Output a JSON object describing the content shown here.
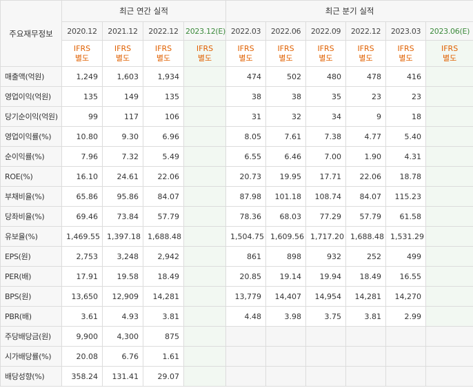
{
  "header": {
    "corner_label": "주요재무정보",
    "annual_group": "최근 연간 실적",
    "quarter_group": "최근 분기 실적",
    "annual_periods": [
      "2020.12",
      "2021.12",
      "2022.12",
      "2023.12(E)"
    ],
    "quarter_periods": [
      "2022.03",
      "2022.06",
      "2022.09",
      "2022.12",
      "2023.03",
      "2023.06(E)"
    ],
    "ifrs_line1": "IFRS",
    "ifrs_line2": "별도"
  },
  "colors": {
    "ifrs_orange": "#e06000",
    "estimate_green": "#3c8a3c",
    "estimate_bg": "#f2f8f2",
    "label_bg": "#f7f7f7"
  },
  "rows": [
    {
      "label": "매출액(억원)",
      "annual": [
        "1,249",
        "1,603",
        "1,934",
        ""
      ],
      "quarter": [
        "474",
        "502",
        "480",
        "478",
        "416",
        ""
      ]
    },
    {
      "label": "영업이익(억원)",
      "annual": [
        "135",
        "149",
        "135",
        ""
      ],
      "quarter": [
        "38",
        "38",
        "35",
        "23",
        "23",
        ""
      ]
    },
    {
      "label": "당기순이익(억원)",
      "annual": [
        "99",
        "117",
        "106",
        ""
      ],
      "quarter": [
        "31",
        "32",
        "34",
        "9",
        "18",
        ""
      ]
    },
    {
      "label": "영업이익률(%)",
      "annual": [
        "10.80",
        "9.30",
        "6.96",
        ""
      ],
      "quarter": [
        "8.05",
        "7.61",
        "7.38",
        "4.77",
        "5.40",
        ""
      ]
    },
    {
      "label": "순이익률(%)",
      "annual": [
        "7.96",
        "7.32",
        "5.49",
        ""
      ],
      "quarter": [
        "6.55",
        "6.46",
        "7.00",
        "1.90",
        "4.31",
        ""
      ]
    },
    {
      "label": "ROE(%)",
      "annual": [
        "16.10",
        "24.61",
        "22.06",
        ""
      ],
      "quarter": [
        "20.73",
        "19.95",
        "17.71",
        "22.06",
        "18.78",
        ""
      ]
    },
    {
      "label": "부채비율(%)",
      "annual": [
        "65.86",
        "95.86",
        "84.07",
        ""
      ],
      "quarter": [
        "87.98",
        "101.18",
        "108.74",
        "84.07",
        "115.23",
        ""
      ]
    },
    {
      "label": "당좌비율(%)",
      "annual": [
        "69.46",
        "73.84",
        "57.79",
        ""
      ],
      "quarter": [
        "78.36",
        "68.03",
        "77.29",
        "57.79",
        "61.58",
        ""
      ]
    },
    {
      "label": "유보율(%)",
      "annual": [
        "1,469.55",
        "1,397.18",
        "1,688.48",
        ""
      ],
      "quarter": [
        "1,504.75",
        "1,609.56",
        "1,717.20",
        "1,688.48",
        "1,531.29",
        ""
      ]
    },
    {
      "label": "EPS(원)",
      "annual": [
        "2,753",
        "3,248",
        "2,942",
        ""
      ],
      "quarter": [
        "861",
        "898",
        "932",
        "252",
        "499",
        ""
      ]
    },
    {
      "label": "PER(배)",
      "annual": [
        "17.91",
        "19.58",
        "18.49",
        ""
      ],
      "quarter": [
        "20.85",
        "19.14",
        "19.94",
        "18.49",
        "16.55",
        ""
      ]
    },
    {
      "label": "BPS(원)",
      "annual": [
        "13,650",
        "12,909",
        "14,281",
        ""
      ],
      "quarter": [
        "13,779",
        "14,407",
        "14,954",
        "14,281",
        "14,270",
        ""
      ]
    },
    {
      "label": "PBR(배)",
      "annual": [
        "3.61",
        "4.93",
        "3.81",
        ""
      ],
      "quarter": [
        "4.48",
        "3.98",
        "3.75",
        "3.81",
        "2.99",
        ""
      ]
    },
    {
      "label": "주당배당금(원)",
      "annual": [
        "9,900",
        "4,300",
        "875",
        ""
      ],
      "quarter": [
        "",
        "",
        "",
        "",
        "",
        ""
      ]
    },
    {
      "label": "시가배당률(%)",
      "annual": [
        "20.08",
        "6.76",
        "1.61",
        ""
      ],
      "quarter": [
        "",
        "",
        "",
        "",
        "",
        ""
      ]
    },
    {
      "label": "배당성향(%)",
      "annual": [
        "358.24",
        "131.41",
        "29.07",
        ""
      ],
      "quarter": [
        "",
        "",
        "",
        "",
        "",
        ""
      ]
    }
  ]
}
